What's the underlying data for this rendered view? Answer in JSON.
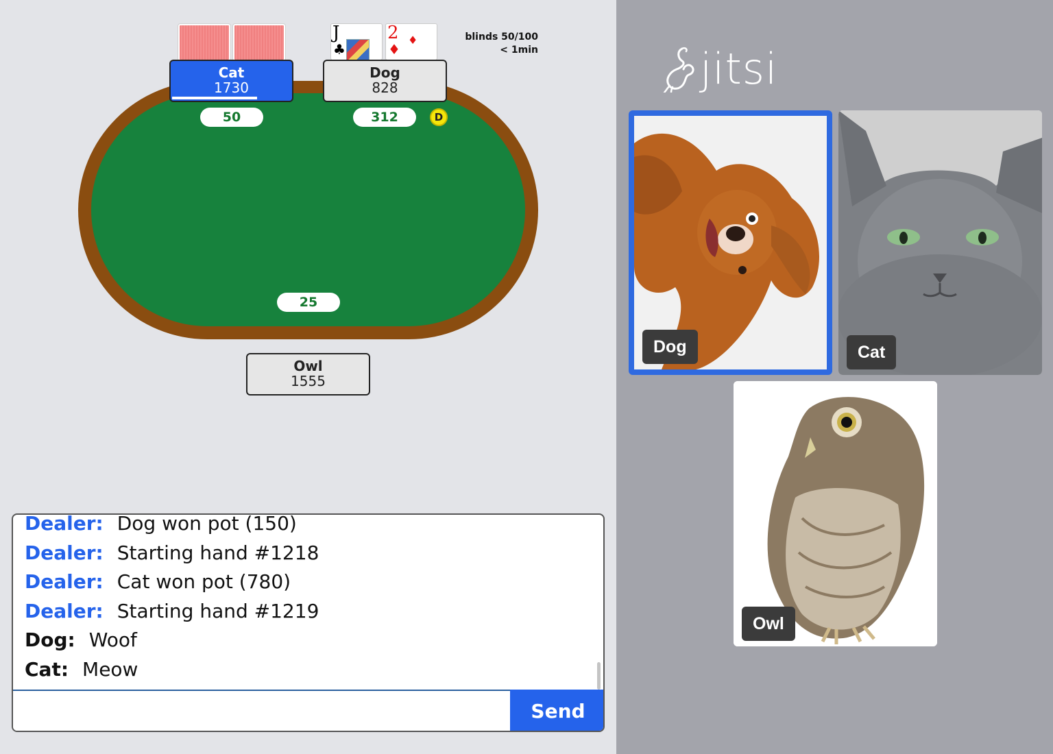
{
  "table": {
    "blinds": "blinds 50/100",
    "timer": "< 1min",
    "dealer_button": "D",
    "pot": "25"
  },
  "players": {
    "cat": {
      "name": "Cat",
      "stack": "1730",
      "bet": "50",
      "cards": "face-down"
    },
    "dog": {
      "name": "Dog",
      "stack": "828",
      "bet": "312",
      "cards": [
        {
          "rank": "J",
          "suit": "♣"
        },
        {
          "rank": "2",
          "suit": "♦"
        }
      ]
    },
    "owl": {
      "name": "Owl",
      "stack": "1555"
    }
  },
  "chat": {
    "messages": [
      {
        "sender": "Dealer:",
        "text": "Dog won pot (150)"
      },
      {
        "sender": "Dealer:",
        "text": "Starting hand #1218"
      },
      {
        "sender": "Dealer:",
        "text": "Cat won pot (780)"
      },
      {
        "sender": "Dealer:",
        "text": "Starting hand #1219"
      },
      {
        "sender": "Dog:",
        "text": "Woof"
      },
      {
        "sender": "Cat:",
        "text": "Meow"
      }
    ],
    "input_value": "",
    "send_label": "Send"
  },
  "jitsi": {
    "logo_text": "jitsi",
    "participants": [
      {
        "name": "Dog",
        "speaking": true
      },
      {
        "name": "Cat",
        "speaking": false
      },
      {
        "name": "Owl",
        "speaking": false
      }
    ]
  },
  "colors": {
    "accent": "#2563eb",
    "felt": "#17823d",
    "rim": "#8a4d10",
    "bet_text": "#14782e",
    "dealer_button": "#f5e60a"
  }
}
